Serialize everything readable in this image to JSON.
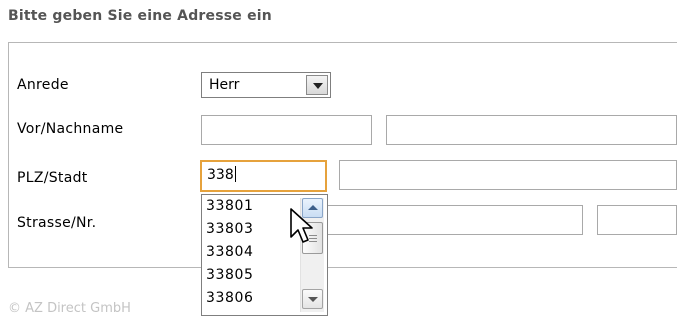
{
  "section_title": "Bitte geben Sie eine Adresse ein",
  "form": {
    "salutation": {
      "label": "Anrede",
      "selected": "Herr"
    },
    "name": {
      "label": "Vor/Nachname",
      "first_value": "",
      "last_value": ""
    },
    "zip_city": {
      "label": "PLZ/Stadt",
      "zip_value": "338",
      "city_value": ""
    },
    "street": {
      "label": "Strasse/Nr.",
      "street_value": "",
      "number_value": ""
    }
  },
  "autocomplete": {
    "items": [
      "33801",
      "33803",
      "33804",
      "33805",
      "33806"
    ]
  },
  "footer": {
    "copyright": "© AZ Direct GmbH"
  },
  "colors": {
    "active_border": "#e6a23c",
    "footer_text": "#c4c4c4"
  },
  "icons": {
    "select_arrow": "chevron-down-icon",
    "scroll_up": "arrow-up-icon",
    "scroll_down": "arrow-down-icon",
    "cursor": "mouse-pointer-icon"
  }
}
